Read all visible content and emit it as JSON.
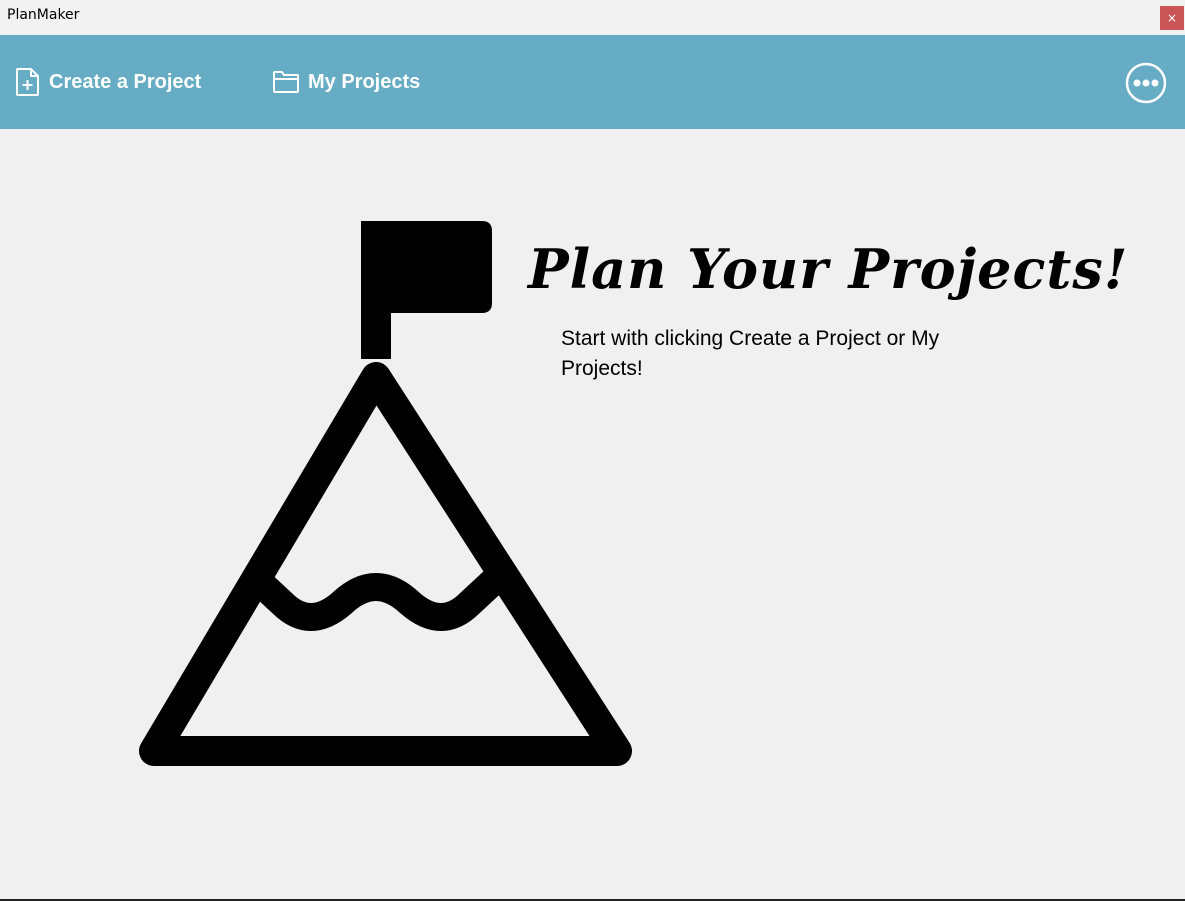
{
  "window": {
    "title": "PlanMaker",
    "close_label": "×"
  },
  "navbar": {
    "create_label": "Create a Project",
    "projects_label": "My Projects",
    "bg_color": "#66acc4"
  },
  "main": {
    "headline": "Plan Your Projects!",
    "subtext": "Start with clicking Create a Project or My Projects!"
  },
  "icons": {
    "create": "add-file-icon",
    "projects": "folder-icon",
    "more": "more-options-icon",
    "hero": "mountain-flag-icon"
  }
}
